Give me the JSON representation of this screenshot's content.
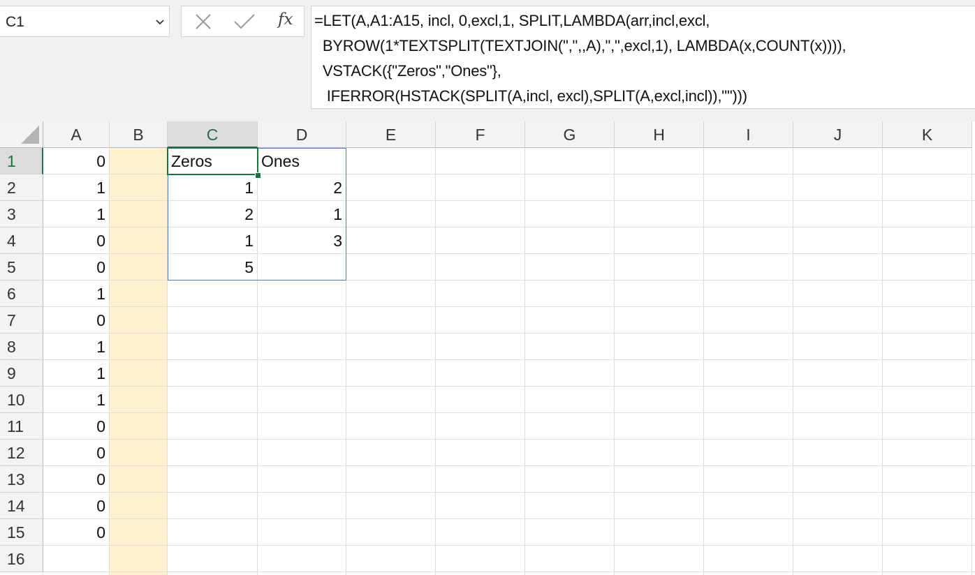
{
  "name_box": {
    "value": "C1"
  },
  "formula_bar": {
    "cancel_icon": "x-icon",
    "enter_icon": "check-icon",
    "fx_label": "fx",
    "lines": [
      "=LET(A,A1:A15, incl, 0,excl,1, SPLIT,LAMBDA(arr,incl,excl,",
      "  BYROW(1*TEXTSPLIT(TEXTJOIN(\",\",,A),\",\",excl,1), LAMBDA(x,COUNT(x)))),",
      "  VSTACK({\"Zeros\",\"Ones\"},",
      "   IFERROR(HSTACK(SPLIT(A,incl, excl),SPLIT(A,excl,incl)),\"\")))"
    ]
  },
  "columns": [
    "A",
    "B",
    "C",
    "D",
    "E",
    "F",
    "G",
    "H",
    "I",
    "J",
    "K"
  ],
  "rows": [
    "1",
    "2",
    "3",
    "4",
    "5",
    "6",
    "7",
    "8",
    "9",
    "10",
    "11",
    "12",
    "13",
    "14",
    "15",
    "16"
  ],
  "selected_cell": "C1",
  "column_A": [
    "0",
    "1",
    "1",
    "0",
    "0",
    "1",
    "0",
    "1",
    "1",
    "1",
    "0",
    "0",
    "0",
    "0",
    "0"
  ],
  "column_C": [
    "Zeros",
    "1",
    "2",
    "1",
    "5"
  ],
  "column_D": [
    "Ones",
    "2",
    "1",
    "3",
    ""
  ],
  "colors": {
    "highlight_column_B": "#fff2cc",
    "selection": "#1e7145",
    "spill_border": "#4a7fc1"
  }
}
